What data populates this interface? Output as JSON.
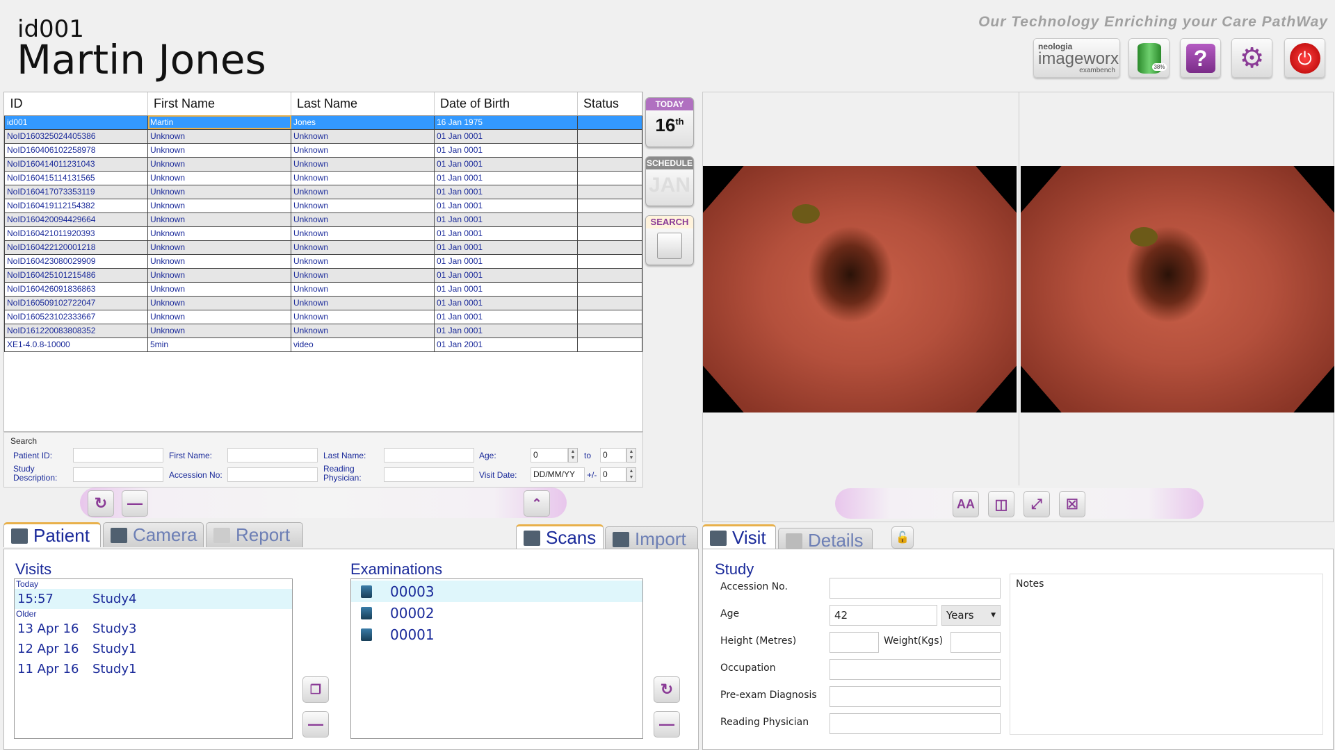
{
  "header": {
    "patient_id": "id001",
    "patient_name": "Martin Jones",
    "tagline": "Our Technology Enriching your Care PathWay",
    "logo": {
      "line1": "neologia",
      "line2": "imageworx",
      "line3": "exambench"
    },
    "disk_usage": "38%"
  },
  "grid": {
    "columns": [
      "ID",
      "First Name",
      "Last Name",
      "Date of Birth",
      "Status"
    ],
    "rows": [
      [
        "id001",
        "Martin",
        "Jones",
        "16 Jan 1975",
        ""
      ],
      [
        "NoID160325024405386",
        "Unknown",
        "Unknown",
        "01 Jan 0001",
        ""
      ],
      [
        "NoID160406102258978",
        "Unknown",
        "Unknown",
        "01 Jan 0001",
        ""
      ],
      [
        "NoID160414011231043",
        "Unknown",
        "Unknown",
        "01 Jan 0001",
        ""
      ],
      [
        "NoID160415114131565",
        "Unknown",
        "Unknown",
        "01 Jan 0001",
        ""
      ],
      [
        "NoID160417073353119",
        "Unknown",
        "Unknown",
        "01 Jan 0001",
        ""
      ],
      [
        "NoID160419112154382",
        "Unknown",
        "Unknown",
        "01 Jan 0001",
        ""
      ],
      [
        "NoID160420094429664",
        "Unknown",
        "Unknown",
        "01 Jan 0001",
        ""
      ],
      [
        "NoID160421011920393",
        "Unknown",
        "Unknown",
        "01 Jan 0001",
        ""
      ],
      [
        "NoID160422120001218",
        "Unknown",
        "Unknown",
        "01 Jan 0001",
        ""
      ],
      [
        "NoID160423080029909",
        "Unknown",
        "Unknown",
        "01 Jan 0001",
        ""
      ],
      [
        "NoID160425101215486",
        "Unknown",
        "Unknown",
        "01 Jan 0001",
        ""
      ],
      [
        "NoID160426091836863",
        "Unknown",
        "Unknown",
        "01 Jan 0001",
        ""
      ],
      [
        "NoID160509102722047",
        "Unknown",
        "Unknown",
        "01 Jan 0001",
        ""
      ],
      [
        "NoID160523102333667",
        "Unknown",
        "Unknown",
        "01 Jan 0001",
        ""
      ],
      [
        "NoID161220083808352",
        "Unknown",
        "Unknown",
        "01 Jan 0001",
        ""
      ],
      [
        "XE1-4.0.8-10000",
        "5min",
        "video",
        "01 Jan 2001",
        ""
      ]
    ]
  },
  "side": {
    "today_label": "TODAY",
    "today_day": "16",
    "today_suffix": "th",
    "schedule_label": "SCHEDULE",
    "schedule_month": "JAN",
    "search_label": "SEARCH"
  },
  "search": {
    "title": "Search",
    "patient_id": "Patient ID:",
    "first_name": "First Name:",
    "last_name": "Last Name:",
    "age": "Age:",
    "age_from": "0",
    "to": "to",
    "age_to": "0",
    "study_desc": "Study Description:",
    "accession": "Accession No:",
    "reading_phys": "Reading Physician:",
    "visit_date": "Visit Date:",
    "visit_date_ph": "DD/MM/YY",
    "pm": "+/-",
    "visit_pm": "0"
  },
  "tabs_left": {
    "patient": "Patient",
    "camera": "Camera",
    "report": "Report"
  },
  "tabs_mid": {
    "scans": "Scans",
    "import": "Import"
  },
  "tabs_right": {
    "visit": "Visit",
    "details": "Details"
  },
  "visits": {
    "title": "Visits",
    "today": "Today",
    "older": "Older",
    "today_items": [
      {
        "date": "15:57",
        "study": "Study4"
      }
    ],
    "older_items": [
      {
        "date": "13 Apr 16",
        "study": "Study3"
      },
      {
        "date": "12 Apr 16",
        "study": "Study1"
      },
      {
        "date": "11 Apr 16",
        "study": "Study1"
      }
    ]
  },
  "exams": {
    "title": "Examinations",
    "items": [
      "00003",
      "00002",
      "00001"
    ]
  },
  "study": {
    "title": "Study",
    "accession": "Accession No.",
    "age": "Age",
    "age_value": "42",
    "age_unit": "Years",
    "height": "Height (Metres)",
    "weight": "Weight(Kgs)",
    "occupation": "Occupation",
    "pre_exam": "Pre-exam Diagnosis",
    "reading": "Reading Physician",
    "notes": "Notes"
  },
  "colors": {
    "accent": "#8a3b96",
    "text_blue": "#1a2a9a",
    "selection": "#3399ff"
  }
}
